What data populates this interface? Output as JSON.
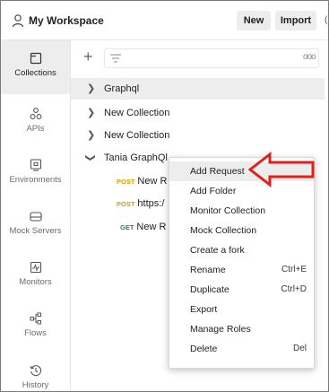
{
  "header": {
    "workspace_title": "My Workspace",
    "new_label": "New",
    "import_label": "Import"
  },
  "rail": {
    "items": [
      {
        "label": "Collections",
        "icon": "collections-icon",
        "active": true
      },
      {
        "label": "APIs",
        "icon": "apis-icon",
        "active": false
      },
      {
        "label": "Environments",
        "icon": "environments-icon",
        "active": false
      },
      {
        "label": "Mock Servers",
        "icon": "mock-servers-icon",
        "active": false
      },
      {
        "label": "Monitors",
        "icon": "monitors-icon",
        "active": false
      },
      {
        "label": "Flows",
        "icon": "flows-icon",
        "active": false
      },
      {
        "label": "History",
        "icon": "history-icon",
        "active": false
      }
    ]
  },
  "tree": {
    "collections": [
      {
        "name": "Graphql",
        "expanded": false,
        "highlighted": true
      },
      {
        "name": "New Collection",
        "expanded": false,
        "highlighted": false
      },
      {
        "name": "New Collection",
        "expanded": false,
        "highlighted": false
      },
      {
        "name": "Tania GraphQl",
        "expanded": true,
        "highlighted": false
      }
    ],
    "requests": [
      {
        "method": "POST",
        "name": "New R"
      },
      {
        "method": "POST",
        "name": "https:/"
      },
      {
        "method": "GET",
        "name": "New R"
      }
    ]
  },
  "context_menu": {
    "items": [
      {
        "label": "Add Request",
        "shortcut": "",
        "hover": true
      },
      {
        "label": "Add Folder",
        "shortcut": ""
      },
      {
        "label": "Monitor Collection",
        "shortcut": ""
      },
      {
        "label": "Mock Collection",
        "shortcut": ""
      },
      {
        "label": "Create a fork",
        "shortcut": ""
      },
      {
        "label": "Rename",
        "shortcut": "Ctrl+E"
      },
      {
        "label": "Duplicate",
        "shortcut": "Ctrl+D"
      },
      {
        "label": "Export",
        "shortcut": ""
      },
      {
        "label": "Manage Roles",
        "shortcut": ""
      },
      {
        "label": "Delete",
        "shortcut": "Del"
      }
    ]
  },
  "colors": {
    "annotation_arrow": "#e0201b",
    "post_method": "#d6a100",
    "get_method": "#1a8f3d",
    "active_bg": "#ededed"
  }
}
